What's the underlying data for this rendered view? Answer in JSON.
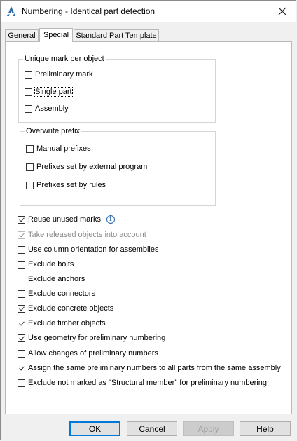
{
  "window": {
    "title": "Numbering - Identical part detection"
  },
  "tabs": [
    {
      "label": "General",
      "active": false
    },
    {
      "label": "Special",
      "active": true
    },
    {
      "label": "Standard Part Template",
      "active": false
    }
  ],
  "group_unique": {
    "title": "Unique mark per object",
    "items": [
      {
        "label": "Preliminary mark",
        "checked": false
      },
      {
        "label": "Single part",
        "checked": false
      },
      {
        "label": "Assembly",
        "checked": false
      }
    ]
  },
  "group_prefix": {
    "title": "Overwrite prefix",
    "items": [
      {
        "label": "Manual prefixes",
        "checked": false
      },
      {
        "label": "Prefixes set by external program",
        "checked": false
      },
      {
        "label": "Prefixes set by rules",
        "checked": false
      }
    ]
  },
  "options": [
    {
      "label": "Reuse unused marks",
      "checked": true,
      "info": true
    },
    {
      "label": "Take released objects into account",
      "checked": true,
      "disabled": true
    },
    {
      "label": "Use column orientation for assemblies",
      "checked": false
    },
    {
      "label": "Exclude bolts",
      "checked": false
    },
    {
      "label": "Exclude anchors",
      "checked": false
    },
    {
      "label": "Exclude connectors",
      "checked": false
    },
    {
      "label": "Exclude concrete objects",
      "checked": true
    },
    {
      "label": "Exclude timber objects",
      "checked": true
    },
    {
      "label": "Use geometry for preliminary numbering",
      "checked": true
    },
    {
      "label": "Allow changes of preliminary numbers",
      "checked": false
    },
    {
      "label": "Assign the same preliminary numbers to all parts from the same assembly",
      "checked": true
    },
    {
      "label": "Exclude not marked as \"Structural member\" for preliminary numbering",
      "checked": false
    }
  ],
  "buttons": {
    "ok": "OK",
    "cancel": "Cancel",
    "apply": "Apply",
    "help": "Help"
  },
  "colors": {
    "focus_border": "#0078d7",
    "info_icon": "#2563a8"
  }
}
